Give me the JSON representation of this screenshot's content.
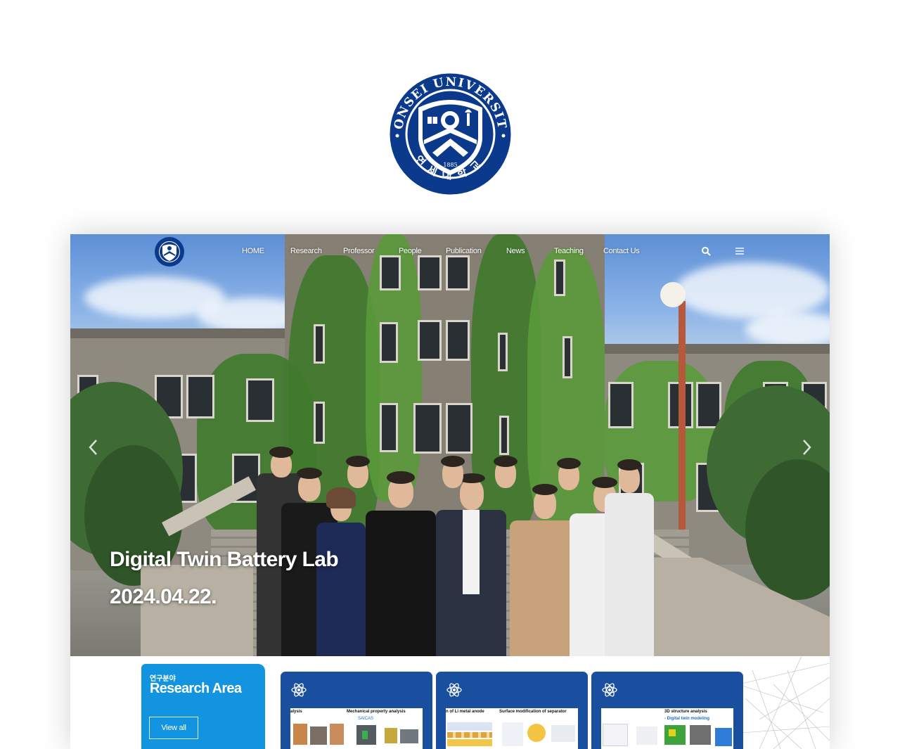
{
  "seal": {
    "top_text": "YONSEI UNIVERSITY",
    "year": "1885",
    "bottom_text": "연세대학교",
    "colors": {
      "navy": "#0b3a8c",
      "white": "#ffffff"
    }
  },
  "nav": {
    "items": [
      {
        "label": "HOME"
      },
      {
        "label": "Research"
      },
      {
        "label": "Professor"
      },
      {
        "label": "People"
      },
      {
        "label": "Publication"
      },
      {
        "label": "News"
      },
      {
        "label": "Teaching"
      },
      {
        "label": "Contact Us"
      }
    ],
    "icons": {
      "search": "search-icon",
      "menu": "hamburger-menu-icon",
      "prev": "chevron-left-icon",
      "next": "chevron-right-icon"
    }
  },
  "hero": {
    "title": "Digital Twin Battery Lab",
    "date": "2024.04.22."
  },
  "research_area": {
    "subtitle": "연구분야",
    "title": "Research Area",
    "view_all": "View all",
    "color": "#1294e0"
  },
  "cards": [
    {
      "icon": "atom-icon",
      "captions": [
        "alysis",
        "Mechanical  property analysis"
      ],
      "tag": "SAICAS"
    },
    {
      "icon": "atom-icon",
      "captions": [
        "n of Li metal anode",
        "Surface modification of separator"
      ]
    },
    {
      "icon": "atom-icon",
      "captions": [
        "3D structure analysis"
      ],
      "tag": "- Digital twin modeling"
    }
  ],
  "card_color": "#1a4fa0"
}
